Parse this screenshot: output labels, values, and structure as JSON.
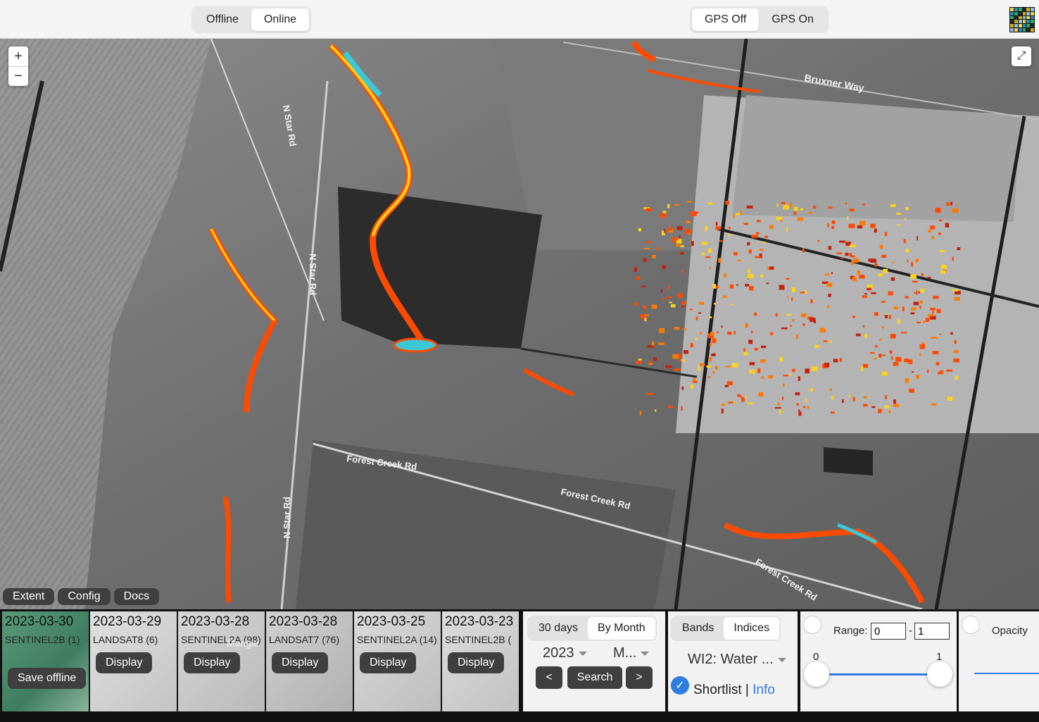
{
  "topbar": {
    "mode_options": [
      {
        "label": "Offline",
        "active": false
      },
      {
        "label": "Online",
        "active": true
      }
    ],
    "gps_options": [
      {
        "label": "GPS Off",
        "active": true
      },
      {
        "label": "GPS On",
        "active": false
      }
    ]
  },
  "map": {
    "zoom_in": "+",
    "zoom_out": "−",
    "road_labels": [
      "N Star Rd",
      "N Star Rd",
      "N Star Rd",
      "Bruxner Way",
      "Forest Creek Rd",
      "Forest Creek Rd",
      "Forest Creek Rd"
    ],
    "buttons": [
      "Extent",
      "Config",
      "Docs"
    ]
  },
  "scenes": [
    {
      "date": "2023-03-30",
      "satellite": "SENTINEL2B (1)",
      "button": "Save offline",
      "selected": true
    },
    {
      "date": "2023-03-29",
      "satellite": "LANDSAT8 (6)",
      "button": "Display",
      "selected": false
    },
    {
      "date": "2023-03-28",
      "satellite": "SENTINEL2A (98)",
      "button": "Display",
      "selected": false
    },
    {
      "date": "2023-03-28",
      "satellite": "LANDSAT7 (76)",
      "button": "Display",
      "selected": false
    },
    {
      "date": "2023-03-25",
      "satellite": "SENTINEL2A (14)",
      "button": "Display",
      "selected": false
    },
    {
      "date": "2023-03-23",
      "satellite": "SENTINEL2B (",
      "button": "Display",
      "selected": false
    }
  ],
  "thumbnail_label": "Mungle",
  "search_panel": {
    "period_options": [
      {
        "label": "30 days",
        "active": false
      },
      {
        "label": "By Month",
        "active": true
      }
    ],
    "year": "2023",
    "month": "M...",
    "prev": "<",
    "search": "Search",
    "next": ">"
  },
  "bands_panel": {
    "tabs": [
      {
        "label": "Bands",
        "active": false
      },
      {
        "label": "Indices",
        "active": true
      }
    ],
    "index_selected": "WI2: Water ...",
    "shortlist_label": "Shortlist",
    "separator": "|",
    "info_link": "Info",
    "shortlist_checked": true
  },
  "range_panel": {
    "label": "Range:",
    "min_value": "0",
    "dash": "-",
    "max_value": "1",
    "slider_min_label": "0",
    "slider_max_label": "1"
  },
  "opacity_panel": {
    "label": "Opacity"
  },
  "colors": {
    "accent": "#2f7de1",
    "button_dark": "#3f3f3f",
    "water_hot": "#ff4a00",
    "water_mid": "#ffd21a",
    "water_cool": "#3cc8d8"
  }
}
